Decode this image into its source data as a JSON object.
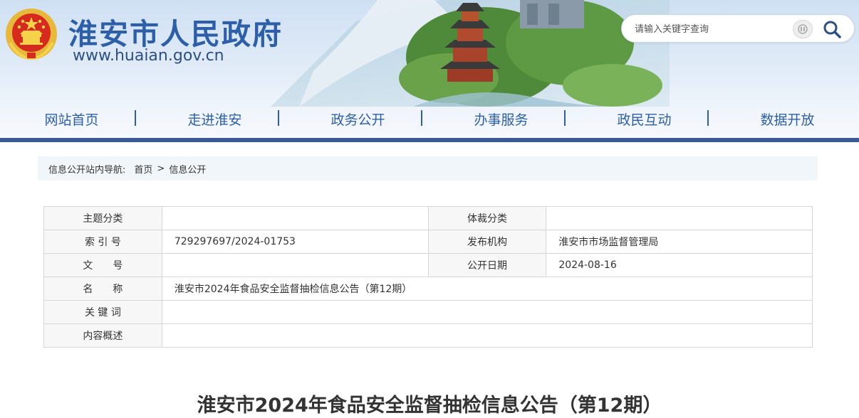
{
  "header": {
    "site_title": "淮安市人民政府",
    "site_url": "www.huaian.gov.cn",
    "brand_color": "#2d5fa8"
  },
  "search": {
    "placeholder": "请输入关键字查询"
  },
  "nav": {
    "items": [
      "网站首页",
      "走进淮安",
      "政务公开",
      "办事服务",
      "政民互动",
      "数据开放"
    ]
  },
  "breadcrumb": {
    "prefix": "信息公开站内导航:",
    "home": "首页",
    "separator": ">",
    "current": "信息公开"
  },
  "meta": {
    "topic_label": "主题分类",
    "topic_value": "",
    "genre_label": "体裁分类",
    "genre_value": "",
    "index_label": "索 引 号",
    "index_value": "729297697/2024-01753",
    "publisher_label": "发布机构",
    "publisher_value": "淮安市市场监督管理局",
    "docno_label": "文　　号",
    "docno_value": "",
    "date_label": "公开日期",
    "date_value": "2024-08-16",
    "name_label": "名　　称",
    "name_value": "淮安市2024年食品安全监督抽检信息公告（第12期）",
    "keywords_label": "关 键 词",
    "keywords_value": "",
    "summary_label": "内容概述",
    "summary_value": ""
  },
  "article": {
    "title": "淮安市2024年食品安全监督抽检信息公告（第12期）"
  }
}
